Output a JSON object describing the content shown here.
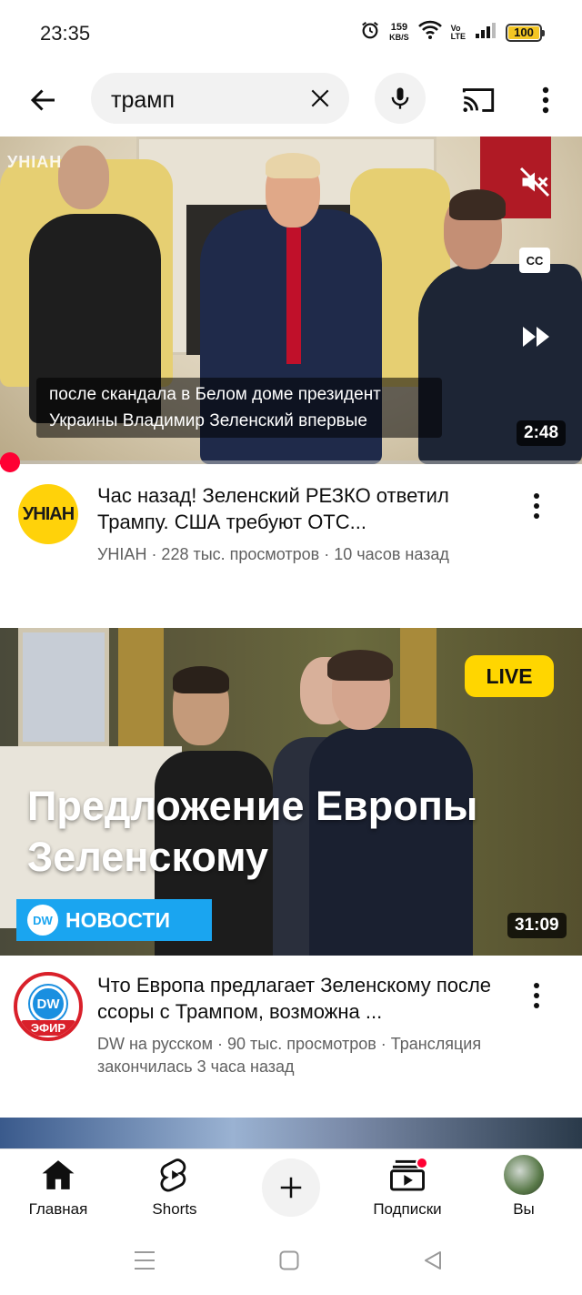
{
  "status_bar": {
    "time": "23:35",
    "net_speed_value": "159",
    "net_speed_unit": "KB/S",
    "volte_top": "Vo",
    "volte_bottom": "LTE",
    "battery": "100",
    "battery_level": 1.0
  },
  "search": {
    "query": "трамп",
    "icons": [
      "back-arrow-icon",
      "clear-icon",
      "microphone-icon",
      "cast-icon",
      "more-vert-icon"
    ]
  },
  "videos": [
    {
      "watermark": "УНIАН",
      "caption": "после скандала в Белом доме президент Украины Владимир Зеленский впервые",
      "duration": "2:48",
      "watch_progress": 0.01,
      "overlay_buttons": {
        "cc": "CC"
      },
      "channel_avatar_text": "УНIАН",
      "title": "Час назад! Зеленский РЕЗКО ответил Трампу. США требуют ОТС...",
      "subtitle": "УНІАН · 228 тыс. просмотров · 10 часов назад"
    },
    {
      "live_label": "LIVE",
      "overlay_title": "Предложение Европы Зеленскому",
      "banner_logo": "DW",
      "banner_text": "НОВОСТИ",
      "duration": "31:09",
      "channel_avatar_logo": "DW",
      "channel_avatar_badge": "ЭФИР",
      "title": "Что Европа предлагает Зеленскому после ссоры с Трампом, возможна ...",
      "subtitle": "DW на русском · 90 тыс. просмотров · Трансляция закончилась 3 часа назад"
    }
  ],
  "bottom_nav": {
    "items": [
      {
        "label": "Главная",
        "icon": "home-icon",
        "active": true
      },
      {
        "label": "Shorts",
        "icon": "shorts-icon"
      },
      {
        "label": "",
        "icon": "create-plus-icon"
      },
      {
        "label": "Подписки",
        "icon": "subscriptions-icon",
        "has_notification_dot": true
      },
      {
        "label": "Вы",
        "icon": "profile-avatar"
      }
    ]
  },
  "system_nav": {
    "icons": [
      "recents-menu-icon",
      "home-square-icon",
      "back-triangle-icon"
    ]
  },
  "colors": {
    "accent_red": "#ff0033",
    "live_yellow": "#ffd600",
    "dw_blue": "#1aa5f0",
    "unian_yellow": "#ffd20a"
  }
}
